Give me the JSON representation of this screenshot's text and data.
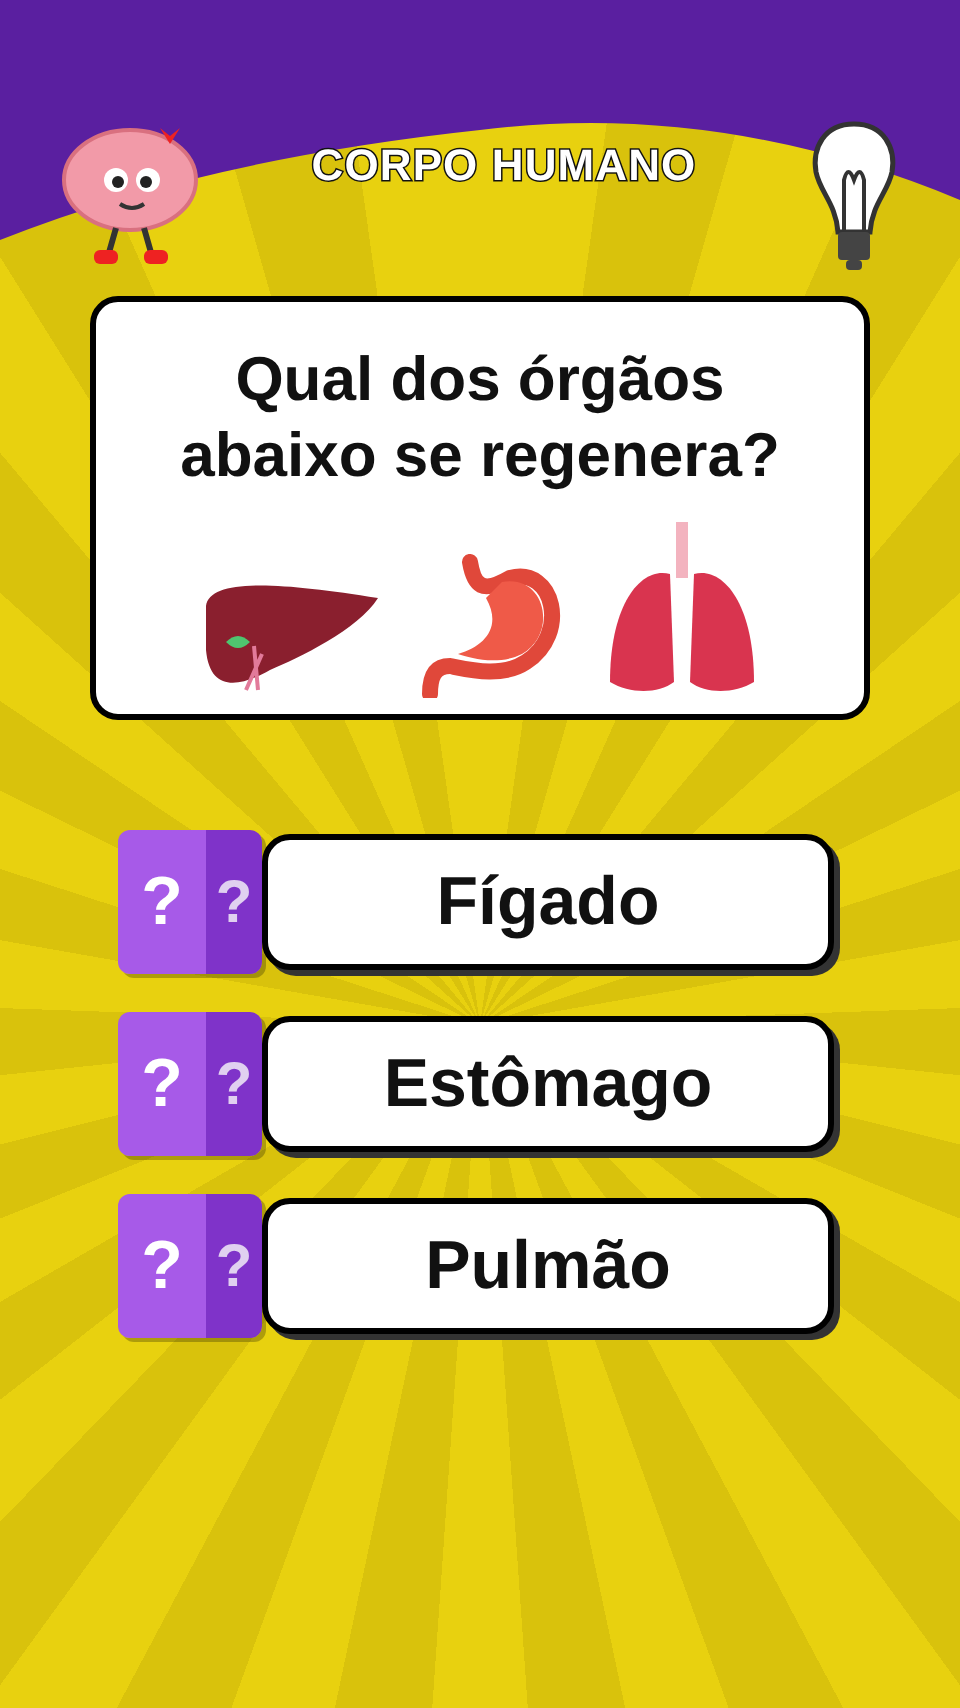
{
  "header": {
    "title": "CORPO HUMANO"
  },
  "question": {
    "text": "Qual dos órgãos abaixo se regenera?"
  },
  "options": [
    {
      "label": "Fígado",
      "cube_marks": [
        "?",
        "?"
      ]
    },
    {
      "label": "Estômago",
      "cube_marks": [
        "?",
        "?"
      ]
    },
    {
      "label": "Pulmão",
      "cube_marks": [
        "?",
        "?"
      ]
    }
  ]
}
